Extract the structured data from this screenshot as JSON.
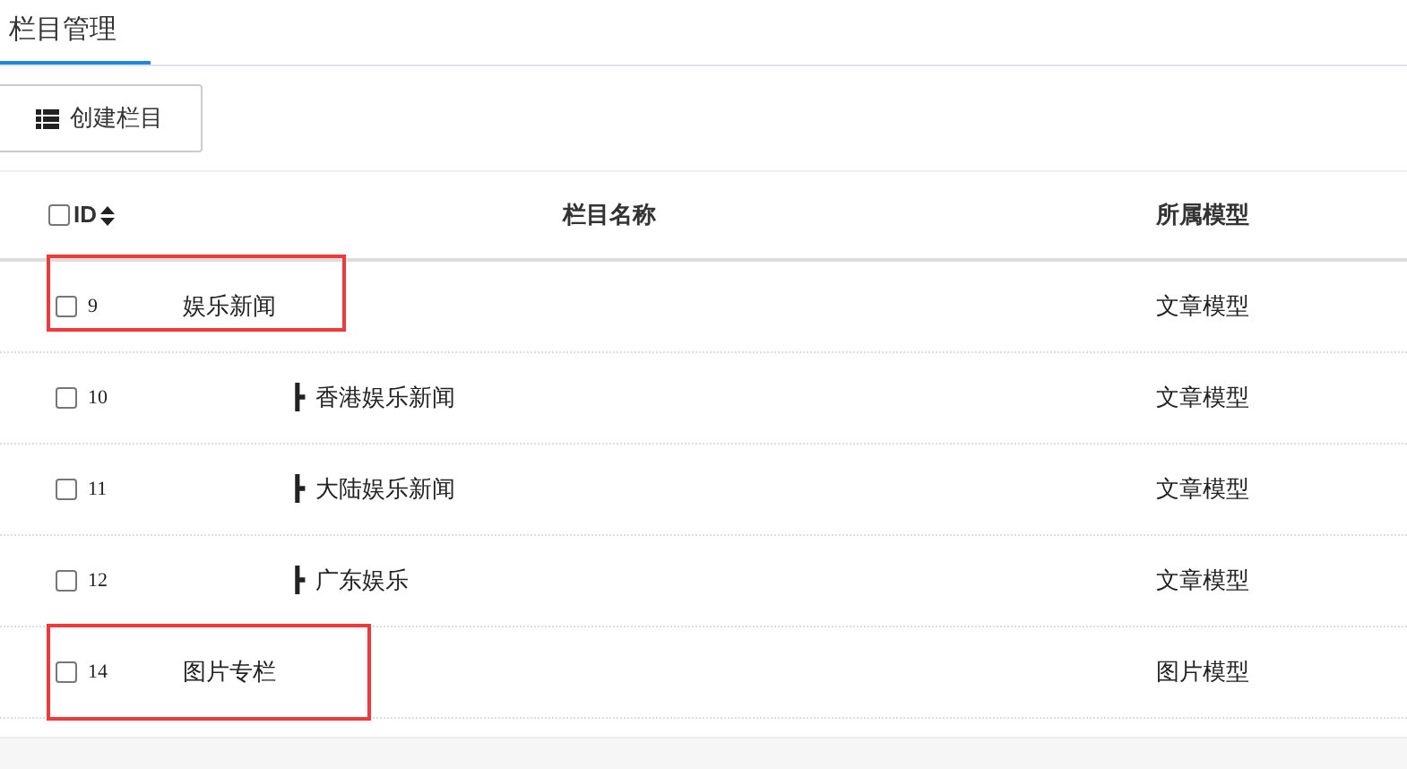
{
  "tabs": [
    {
      "label": "栏目管理",
      "selected": true
    }
  ],
  "create_button": {
    "label": "创建栏目"
  },
  "table": {
    "columns": [
      {
        "label": "ID",
        "sortable": true
      },
      {
        "label": "栏目名称"
      },
      {
        "label": "所属模型"
      }
    ],
    "header_checkbox": {
      "checked": false
    },
    "rows": [
      {
        "id": "9",
        "name": "娱乐新闻",
        "model": "文章模型",
        "checked": false,
        "highlighted": true,
        "children": [
          {
            "id": "10",
            "branch": "┣",
            "name": "香港娱乐新闻",
            "model": "文章模型",
            "checked": false,
            "highlighted": false
          },
          {
            "id": "11",
            "branch": "┣",
            "name": "大陆娱乐新闻",
            "model": "文章模型",
            "checked": false,
            "highlighted": false
          },
          {
            "id": "12",
            "branch": "┣",
            "name": "广东娱乐",
            "model": "文章模型",
            "checked": false,
            "highlighted": false
          }
        ]
      },
      {
        "id": "14",
        "name": "图片专栏",
        "model": "图片模型",
        "checked": false,
        "highlighted": true
      }
    ]
  }
}
